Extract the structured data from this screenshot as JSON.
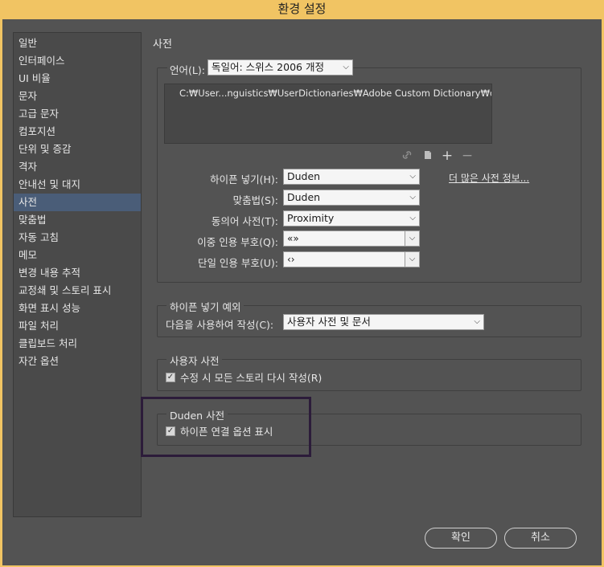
{
  "window": {
    "title": "환경 설정"
  },
  "sidebar": {
    "items": [
      {
        "label": "일반"
      },
      {
        "label": "인터페이스"
      },
      {
        "label": "UI 비율"
      },
      {
        "label": "문자"
      },
      {
        "label": "고급 문자"
      },
      {
        "label": "컴포지션"
      },
      {
        "label": "단위 및 증감"
      },
      {
        "label": "격자"
      },
      {
        "label": "안내선 및 대지"
      },
      {
        "label": "사전",
        "selected": true
      },
      {
        "label": "맞춤법"
      },
      {
        "label": "자동 고침"
      },
      {
        "label": "메모"
      },
      {
        "label": "변경 내용 추적"
      },
      {
        "label": "교정쇄 및 스토리 표시"
      },
      {
        "label": "화면 표시 성능"
      },
      {
        "label": "파일 처리"
      },
      {
        "label": "클립보드 처리"
      },
      {
        "label": "자간 옵션"
      }
    ]
  },
  "main": {
    "section_title": "사전",
    "language": {
      "label": "언어(L):",
      "value": "독일어: 스위스 2006 개정"
    },
    "dictionary_list": [
      "C:₩User...nguistics₩UserDictionaries₩Adobe Custom Dictionary₩de_CH"
    ],
    "list_icons": [
      "link-icon",
      "new-document-icon",
      "plus-icon",
      "minus-icon"
    ],
    "hyphenation": {
      "label": "하이픈 넣기(H):",
      "value": "Duden"
    },
    "spelling": {
      "label": "맞춤법(S):",
      "value": "Duden"
    },
    "thesaurus": {
      "label": "동의어 사전(T):",
      "value": "Proximity"
    },
    "double_quotes": {
      "label": "이중 인용 부호(Q):",
      "value": "«»"
    },
    "single_quotes": {
      "label": "단일 인용 부호(U):",
      "value": "‹›"
    },
    "more_link": "더 많은 사전 정보...",
    "hyphenation_exceptions": {
      "legend": "하이픈 넣기 예외",
      "compose_label": "다음을 사용하여 작성(C):",
      "compose_value": "사용자 사전 및 문서"
    },
    "user_dictionary": {
      "legend": "사용자 사전",
      "recompose_label": "수정 시 모든 스토리 다시 작성(R)",
      "recompose_checked": true
    },
    "duden": {
      "legend": "Duden 사전",
      "show_options_label": "하이픈 연결 옵션 표시",
      "show_options_checked": true
    }
  },
  "footer": {
    "ok_label": "확인",
    "cancel_label": "취소"
  }
}
